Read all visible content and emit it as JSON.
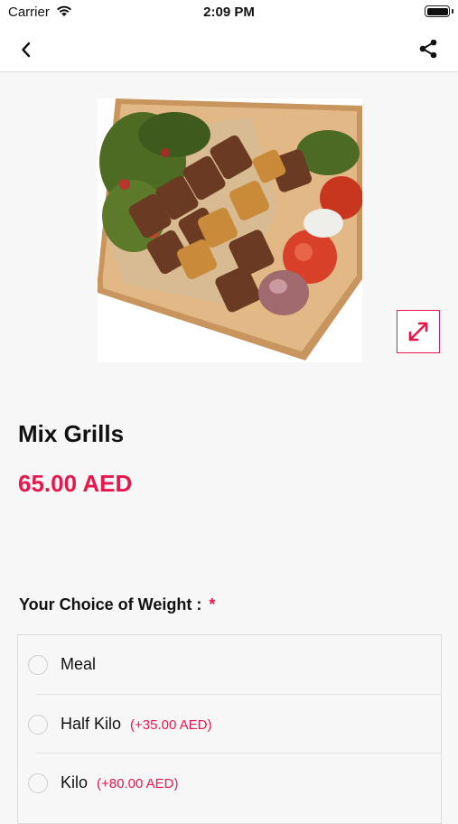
{
  "status_bar": {
    "carrier": "Carrier",
    "time": "2:09 PM"
  },
  "nav": {
    "back_icon": "chevron-left-icon",
    "share_icon": "share-icon"
  },
  "product": {
    "name": "Mix Grills",
    "price": "65.00 AED",
    "expand_icon": "expand-diagonal-icon"
  },
  "options": {
    "label": "Your Choice of Weight :",
    "required_mark": "*",
    "items": [
      {
        "label": "Meal",
        "extra": ""
      },
      {
        "label": "Half Kilo",
        "extra": "(+35.00 AED)"
      },
      {
        "label": "Kilo",
        "extra": "(+80.00 AED)"
      }
    ]
  },
  "colors": {
    "accent": "#e8174b",
    "background": "#f7f7f7"
  }
}
